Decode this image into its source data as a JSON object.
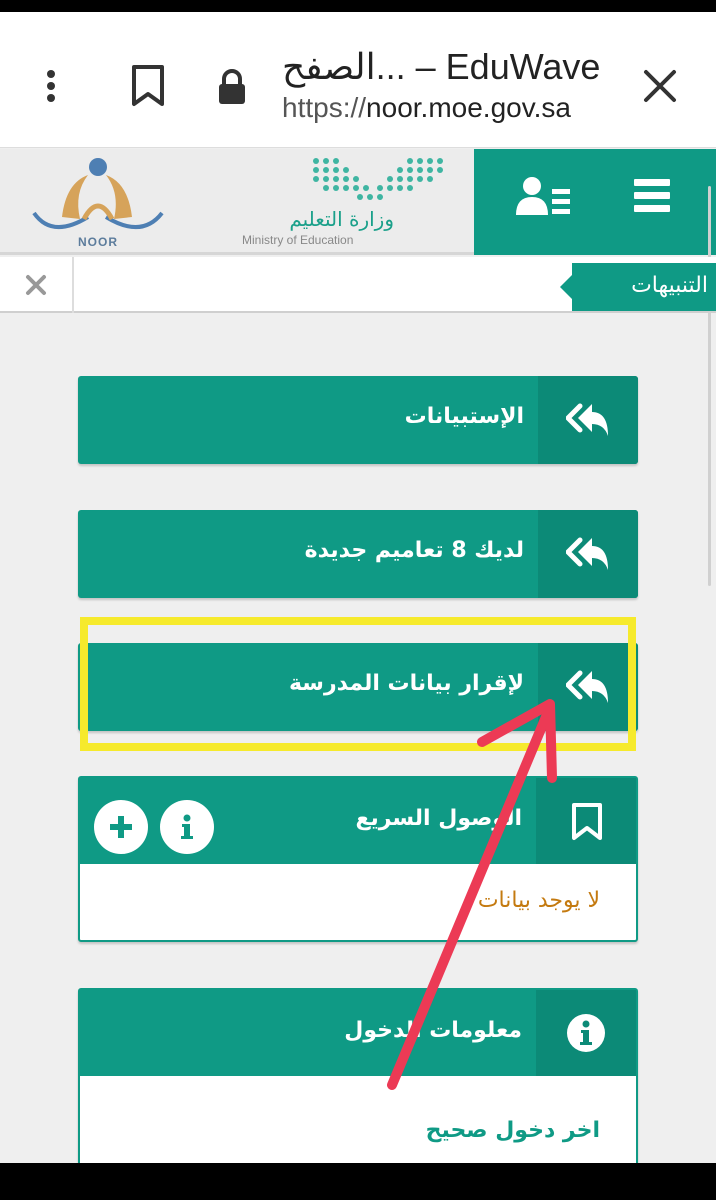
{
  "browser": {
    "tab_title": "الصفح... – EduWave",
    "url_scheme": "https://",
    "url_host": "noor.moe.gov.sa"
  },
  "header": {
    "moe_name_ar": "وزارة التعليم",
    "moe_name_en": "Ministry of Education",
    "noor_label": "NOOR"
  },
  "notifications": {
    "tab_label": "التنبيهات"
  },
  "cards": [
    {
      "label": "الإستبيانات",
      "icon": "reply-all-icon"
    },
    {
      "label": "لديك 8 تعاميم جديدة",
      "icon": "reply-all-icon"
    },
    {
      "label": "لإقرار بيانات المدرسة",
      "icon": "reply-all-icon"
    }
  ],
  "quick_access": {
    "title": "الوصول السريع",
    "empty_text": "لا يوجد بيانات"
  },
  "login_info": {
    "title": "معلومات الدخول",
    "last_login_label": "اخر دخول صحيح"
  },
  "colors": {
    "primary": "#0f9a85",
    "primary_dark": "#0c8a77",
    "highlight": "#f6ea2c",
    "annotation_arrow": "#ec3a55",
    "empty_text": "#c47a10"
  }
}
